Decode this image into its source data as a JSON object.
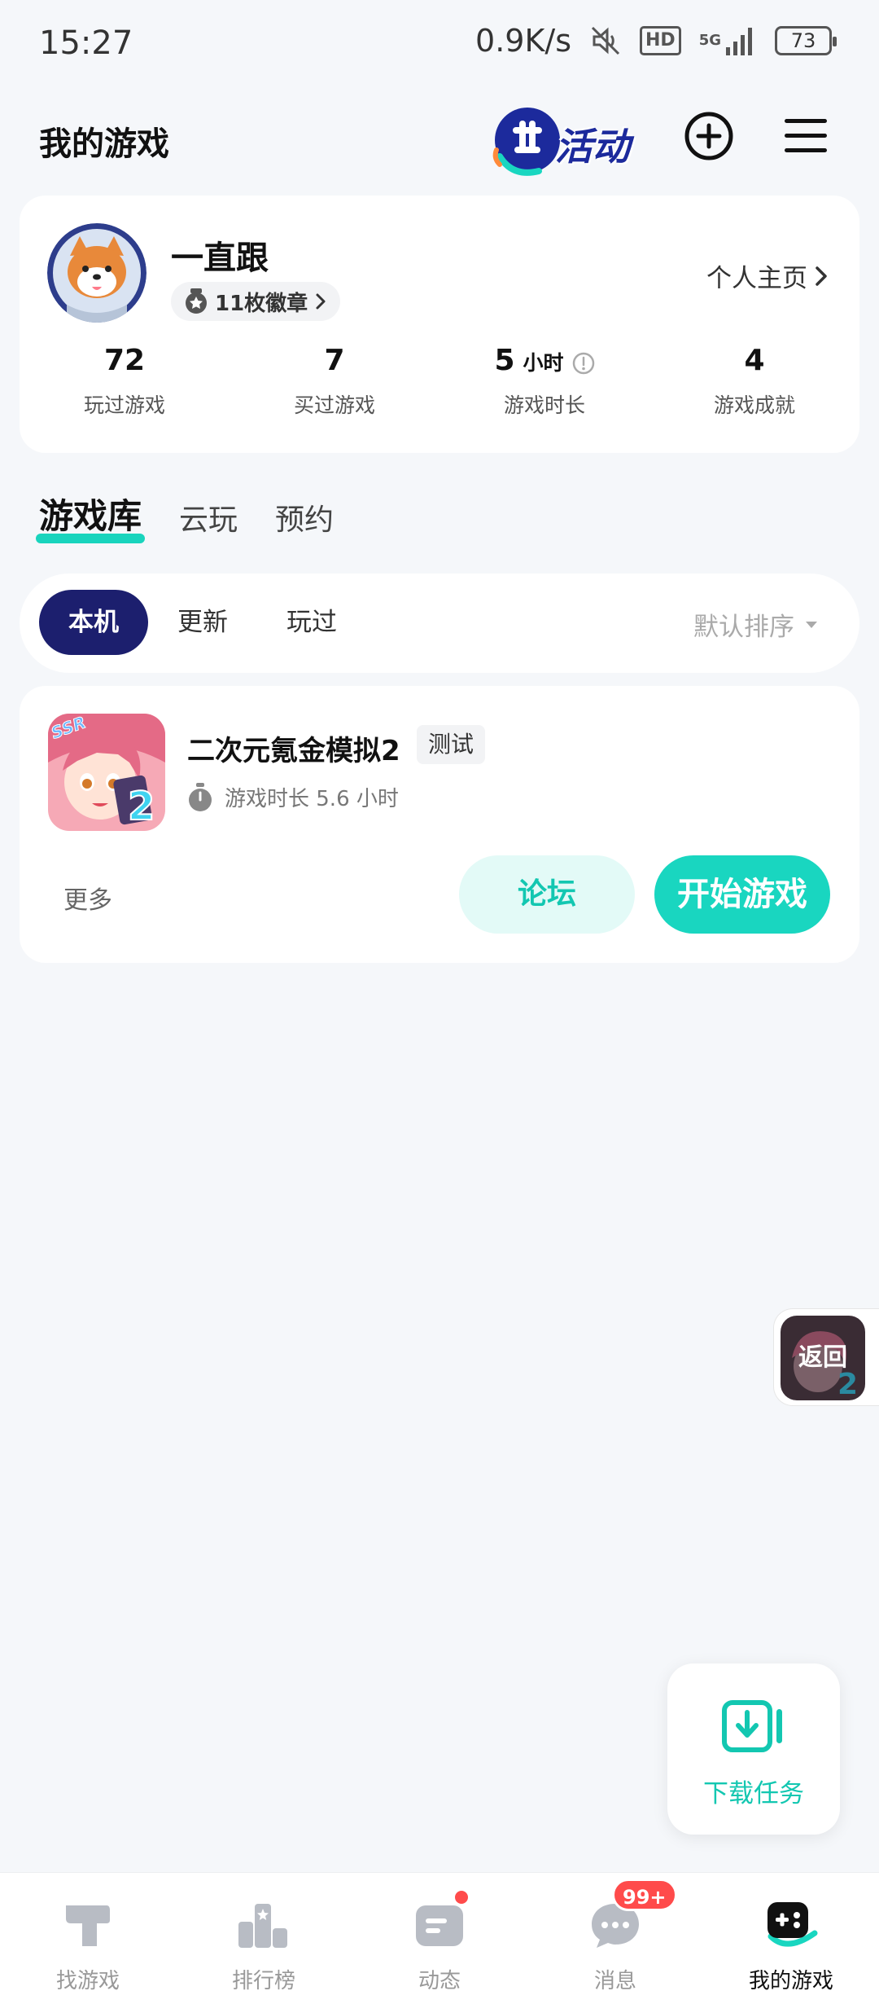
{
  "status_bar": {
    "time": "15:27",
    "speed": "0.9K/s",
    "hd": "HD",
    "network": "5G",
    "battery": "73"
  },
  "header": {
    "title": "我的游戏",
    "activity_label": "活动"
  },
  "profile": {
    "username": "一直跟",
    "badges": "11枚徽章",
    "home_link": "个人主页",
    "stats": [
      {
        "value": "72",
        "unit": "",
        "label": "玩过游戏"
      },
      {
        "value": "7",
        "unit": "",
        "label": "买过游戏"
      },
      {
        "value": "5",
        "unit": "小时",
        "label": "游戏时长"
      },
      {
        "value": "4",
        "unit": "",
        "label": "游戏成就"
      }
    ]
  },
  "tabs": [
    "游戏库",
    "云玩",
    "预约"
  ],
  "filters": {
    "chips": [
      "本机",
      "更新",
      "玩过"
    ],
    "sort": "默认排序"
  },
  "game": {
    "name": "二次元氪金模拟2",
    "tag": "测试",
    "play_time": "游戏时长 5.6 小时",
    "more": "更多",
    "forum": "论坛",
    "start": "开始游戏"
  },
  "float_back": {
    "label": "返回"
  },
  "download": {
    "label": "下载任务"
  },
  "bottom_nav": {
    "items": [
      "找游戏",
      "排行榜",
      "动态",
      "消息",
      "我的游戏"
    ],
    "message_badge": "99+"
  },
  "colors": {
    "accent": "#19d6c0",
    "navy": "#1c1f6e",
    "badge_red": "#ff4b4b"
  }
}
